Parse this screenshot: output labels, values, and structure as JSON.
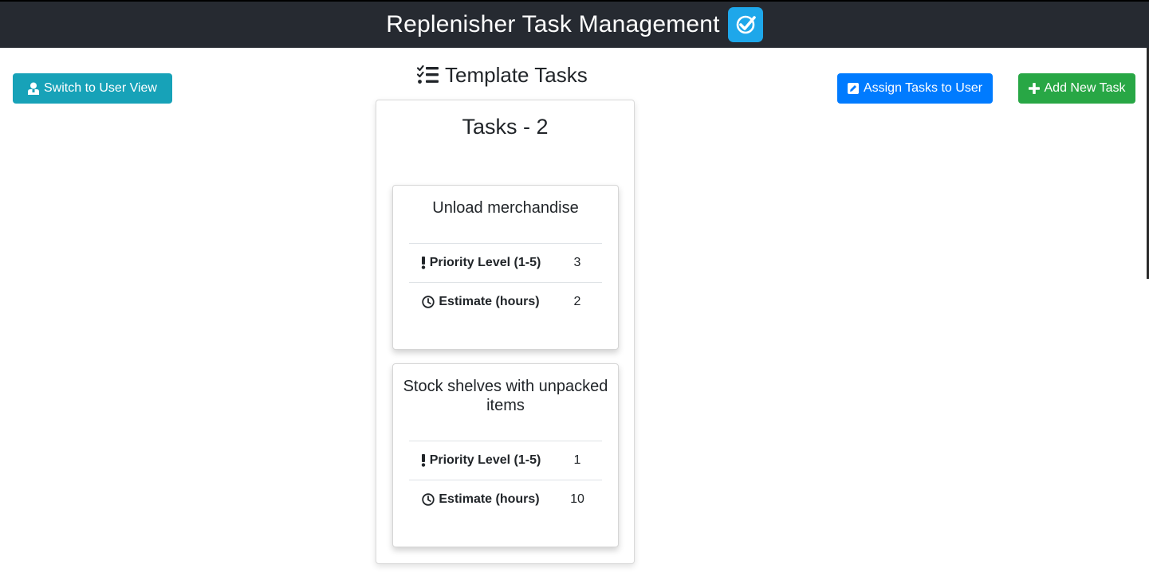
{
  "header": {
    "title": "Replenisher Task Management",
    "logo_icon": "check-badge-icon",
    "logo_color": "#1ea7ea",
    "background": "#262a31"
  },
  "toolbar": {
    "switch_view_label": "Switch to User View",
    "switch_view_icon": "user-icon",
    "assign_label": "Assign Tasks to User",
    "assign_icon": "edit-icon",
    "add_label": "Add New Task",
    "add_icon": "plus-icon",
    "colors": {
      "info": "#17a2b8",
      "primary": "#007bff",
      "success": "#28a745"
    }
  },
  "section": {
    "title": "Template Tasks",
    "icon": "tasks-list-icon"
  },
  "board": {
    "title": "Tasks - 2",
    "tasks": [
      {
        "name": "Unload merchandise",
        "priority_label": "Priority Level (1-5)",
        "priority": "3",
        "estimate_label": "Estimate (hours)",
        "estimate": "2"
      },
      {
        "name": "Stock shelves with unpacked items",
        "priority_label": "Priority Level (1-5)",
        "priority": "1",
        "estimate_label": "Estimate (hours)",
        "estimate": "10"
      }
    ]
  }
}
